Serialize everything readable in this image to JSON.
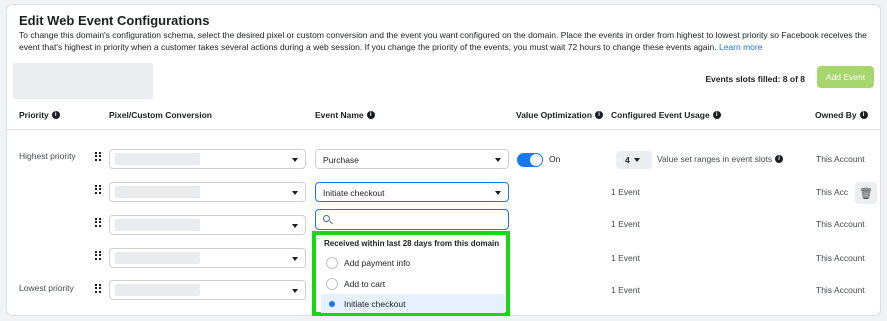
{
  "header": {
    "title": "Edit Web Event Configurations",
    "description": "To change this domain's configuration schema, select the desired pixel or custom conversion and the event you want configured on the domain. Place the events in order from highest to lowest priority so Facebook receives the event that's highest in priority when a customer takes several actions during a web session. If you change the priority of the events, you must wait 72 hours to change these events again.",
    "learn_more": "Learn more"
  },
  "toolbar": {
    "slots_text": "Events slots filled: 8 of 8",
    "add_event": "Add Event"
  },
  "columns": {
    "priority": "Priority",
    "pixel": "Pixel/Custom Conversion",
    "event_name": "Event Name",
    "value_optimization": "Value Optimization",
    "configured_usage": "Configured Event Usage",
    "owned_by": "Owned By"
  },
  "rows": [
    {
      "priority": "Highest priority",
      "event": "Purchase",
      "value_opt": "On",
      "usage_count": "4",
      "usage_text": "Value set ranges in event slots",
      "owner": "This Account"
    },
    {
      "priority": "",
      "event": "Initiate checkout",
      "usage": "1 Event",
      "owner": "This Acc"
    },
    {
      "priority": "",
      "usage": "1 Event",
      "owner": "This Account"
    },
    {
      "priority": "",
      "usage": "1 Event",
      "owner": "This Account"
    },
    {
      "priority": "Lowest priority",
      "usage": "1 Event",
      "owner": "This Account"
    }
  ],
  "dropdown": {
    "search_placeholder": "",
    "section_label": "Received within last 28 days from this domain",
    "options": [
      "Add payment info",
      "Add to cart",
      "Initiate checkout"
    ],
    "selected": "Initiate checkout"
  },
  "colors": {
    "accent": "#1877f2",
    "add_button": "#a6d66d",
    "highlight_border": "#1bd614"
  }
}
